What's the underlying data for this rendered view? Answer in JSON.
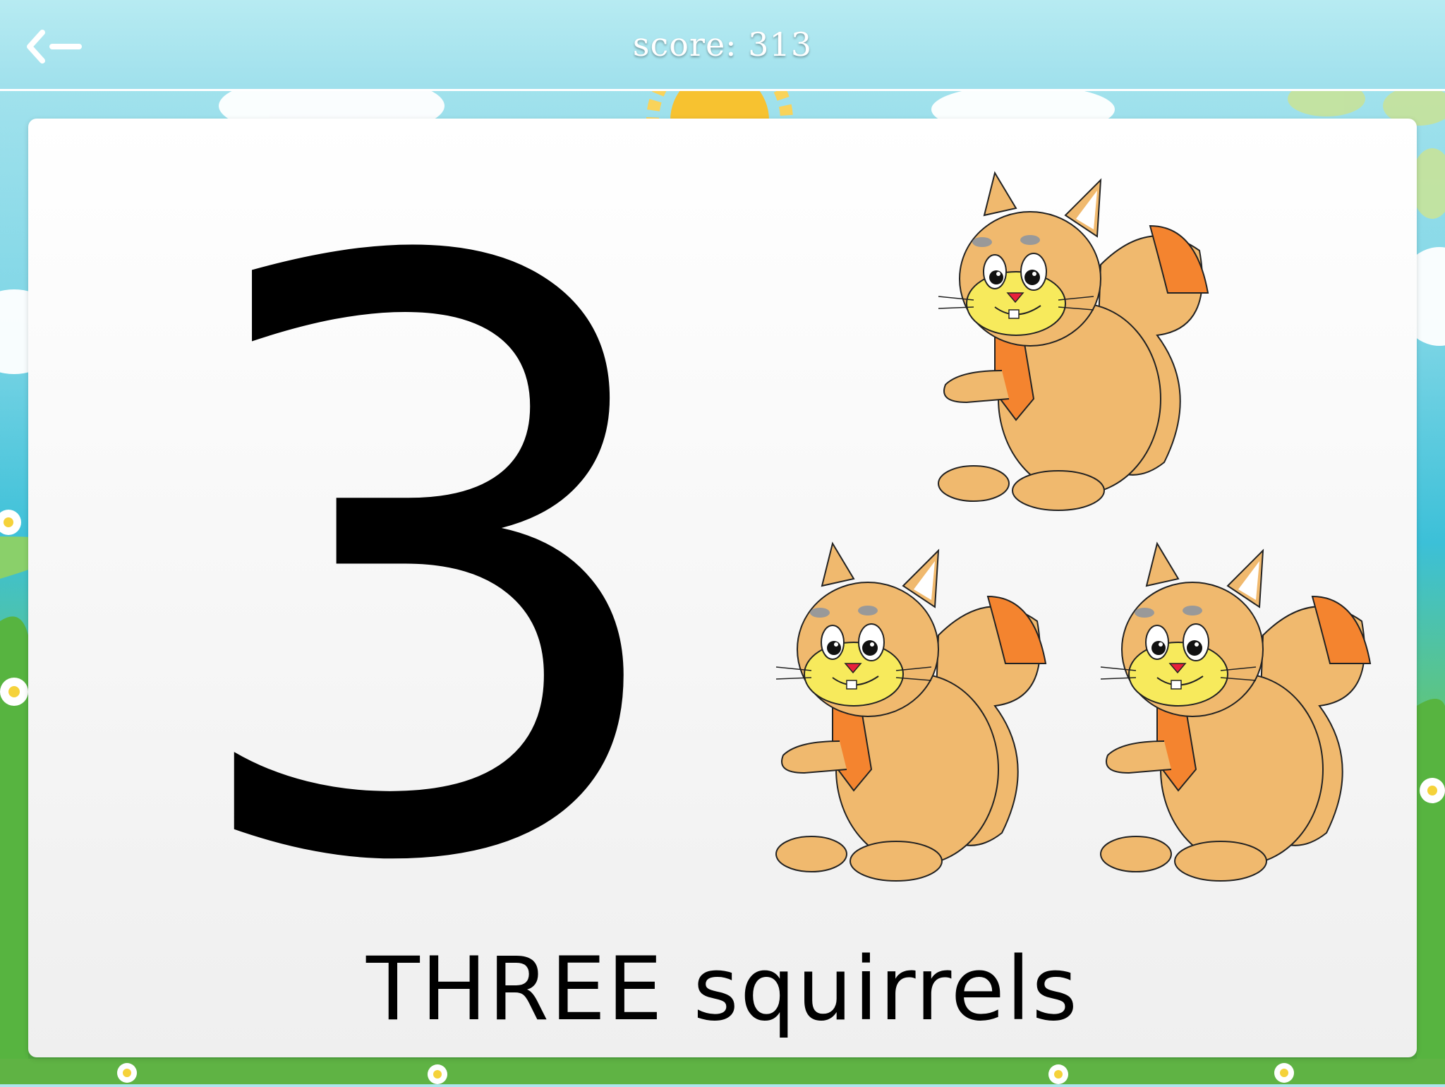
{
  "header": {
    "score_text": "score: 313",
    "back_icon": "back-arrow-icon"
  },
  "lesson": {
    "number": "3",
    "caption": "THREE squirrels",
    "count": 3,
    "item_icon": "squirrel-icon"
  },
  "colors": {
    "squirrel_body": "#f0b96e",
    "squirrel_tail_tip": "#f4842f",
    "squirrel_face": "#f7ea5c",
    "squirrel_nose": "#e8203a",
    "sky": "#9fe0ec"
  }
}
